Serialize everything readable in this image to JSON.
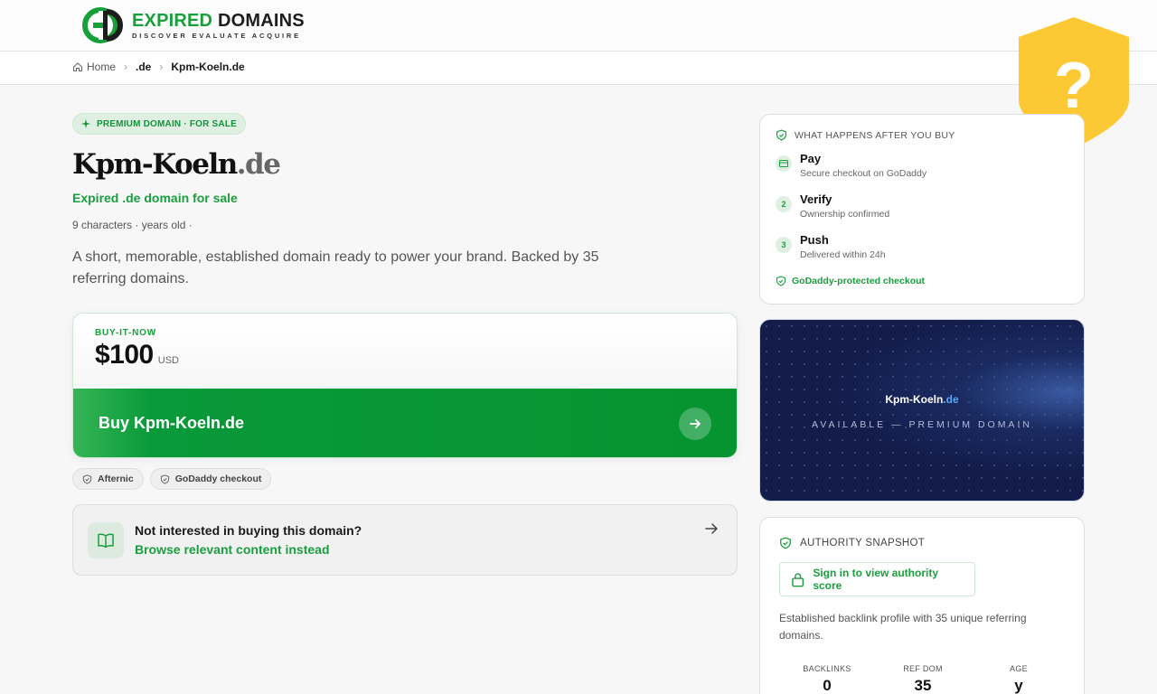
{
  "header": {
    "logo_main_green": "EXPIRED",
    "logo_main_dark": "DOMAINS",
    "logo_tagline": "DISCOVER EVALUATE ACQUIRE",
    "logo_icon": "ed-monogram-icon"
  },
  "breadcrumb": {
    "items": [
      "Home",
      ".de",
      "Kpm-Koeln.de"
    ]
  },
  "badge": {
    "icon": "question-shield-icon",
    "symbol": "?",
    "color": "#fcc934"
  },
  "listing": {
    "tag": "PREMIUM DOMAIN · FOR SALE",
    "domain_name": "Kpm-Koeln",
    "domain_tld": ".de",
    "subtitle": "Expired .de domain for sale",
    "meta": "9 characters · years old ·",
    "description": "A short, memorable, established domain ready to power your brand. Backed by 35 referring domains."
  },
  "buy": {
    "label": "BUY-IT-NOW",
    "price": "$100",
    "currency": "USD",
    "button_label": "Buy Kpm-Koeln.de"
  },
  "chips": [
    "Afternic",
    "GoDaddy checkout"
  ],
  "content_prompt": {
    "question": "Not interested in buying this domain?",
    "action": "Browse relevant content instead"
  },
  "steps": {
    "heading": "WHAT HAPPENS AFTER YOU BUY",
    "items": [
      {
        "marker": "card-icon",
        "title": "Pay",
        "desc": "Secure checkout on GoDaddy"
      },
      {
        "marker": "2",
        "title": "Verify",
        "desc": "Ownership confirmed"
      },
      {
        "marker": "3",
        "title": "Push",
        "desc": "Delivered within 24h"
      }
    ],
    "footer": "GoDaddy-protected checkout"
  },
  "preview": {
    "domain_name": "Kpm-Koeln",
    "domain_tld": ".de",
    "subtitle": "AVAILABLE — PREMIUM DOMAIN"
  },
  "authority": {
    "heading": "AUTHORITY SNAPSHOT",
    "signin_label": "Sign in to view authority score",
    "description": "Established backlink profile with 35 unique referring domains.",
    "stats": [
      {
        "label": "BACKLINKS",
        "value": "0"
      },
      {
        "label": "REF DOM",
        "value": "35"
      },
      {
        "label": "AGE",
        "value": "y"
      }
    ]
  },
  "colors": {
    "brand_green": "#16a03a",
    "button_green": "#05942f",
    "preview_navy": "#131c4a",
    "badge_yellow": "#fcc934"
  }
}
